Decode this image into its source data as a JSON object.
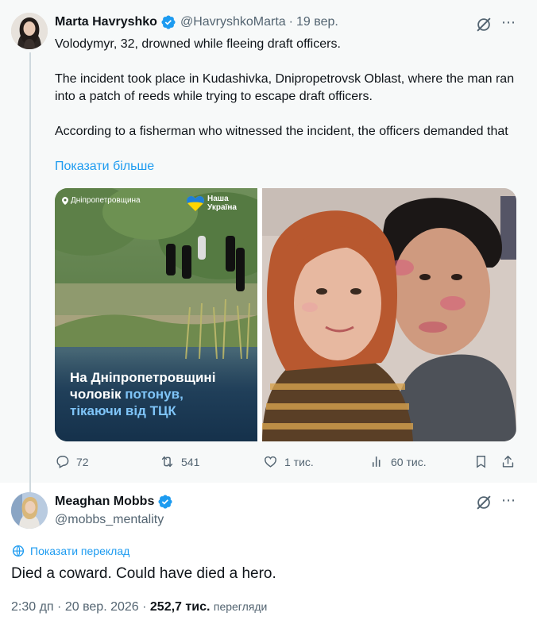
{
  "quoted_tweet": {
    "author_name": "Marta Havryshko",
    "handle": "@HavryshkoMarta",
    "separator": "·",
    "date": "19 вер.",
    "text_lines": [
      "Volodymyr, 32, drowned while fleeing draft officers.",
      "The incident took place in Kudashivka, Dnipropetrovsk Oblast, where the man ran into a patch of reeds while trying to escape draft officers.",
      "According to a fisherman who witnessed the incident, the officers demanded that"
    ],
    "show_more": "Показати більше",
    "media": {
      "left_image": {
        "location_tag": "Дніпропетровщина",
        "logo_line1": "Наша",
        "logo_line2": "Україна",
        "headline_line1": "На Дніпропетровщині",
        "headline_line2_plain": "чоловік ",
        "headline_line2_accent": "потонув,",
        "headline_line3": "тікаючи від ТЦК"
      }
    },
    "stats": {
      "replies": "72",
      "reposts": "541",
      "likes": "1 тис.",
      "views": "60 тис."
    }
  },
  "main_tweet": {
    "author_name": "Meaghan Mobbs",
    "handle": "@mobbs_mentality",
    "translate_label": "Показати переклад",
    "text": "Died a coward. Could have died a hero.",
    "time": "2:30 дп",
    "dot": "·",
    "date": "20 вер. 2026",
    "dot2": "·",
    "views_count": "252,7 тис.",
    "views_label": "перегляди"
  },
  "icons": {
    "verified": "verified-badge-icon",
    "grok": "grok-icon",
    "more": "more-icon",
    "reply": "reply-icon",
    "repost": "repost-icon",
    "like": "like-icon",
    "views": "views-icon",
    "bookmark": "bookmark-icon",
    "share": "share-icon",
    "translate": "globe-icon"
  },
  "colors": {
    "accent": "#1d9bf0",
    "text": "#0f1419",
    "muted": "#536471",
    "quoted_bg": "#f7f9f9",
    "thread_line": "#cfd9de",
    "headline_accent": "#7fc4f7"
  }
}
